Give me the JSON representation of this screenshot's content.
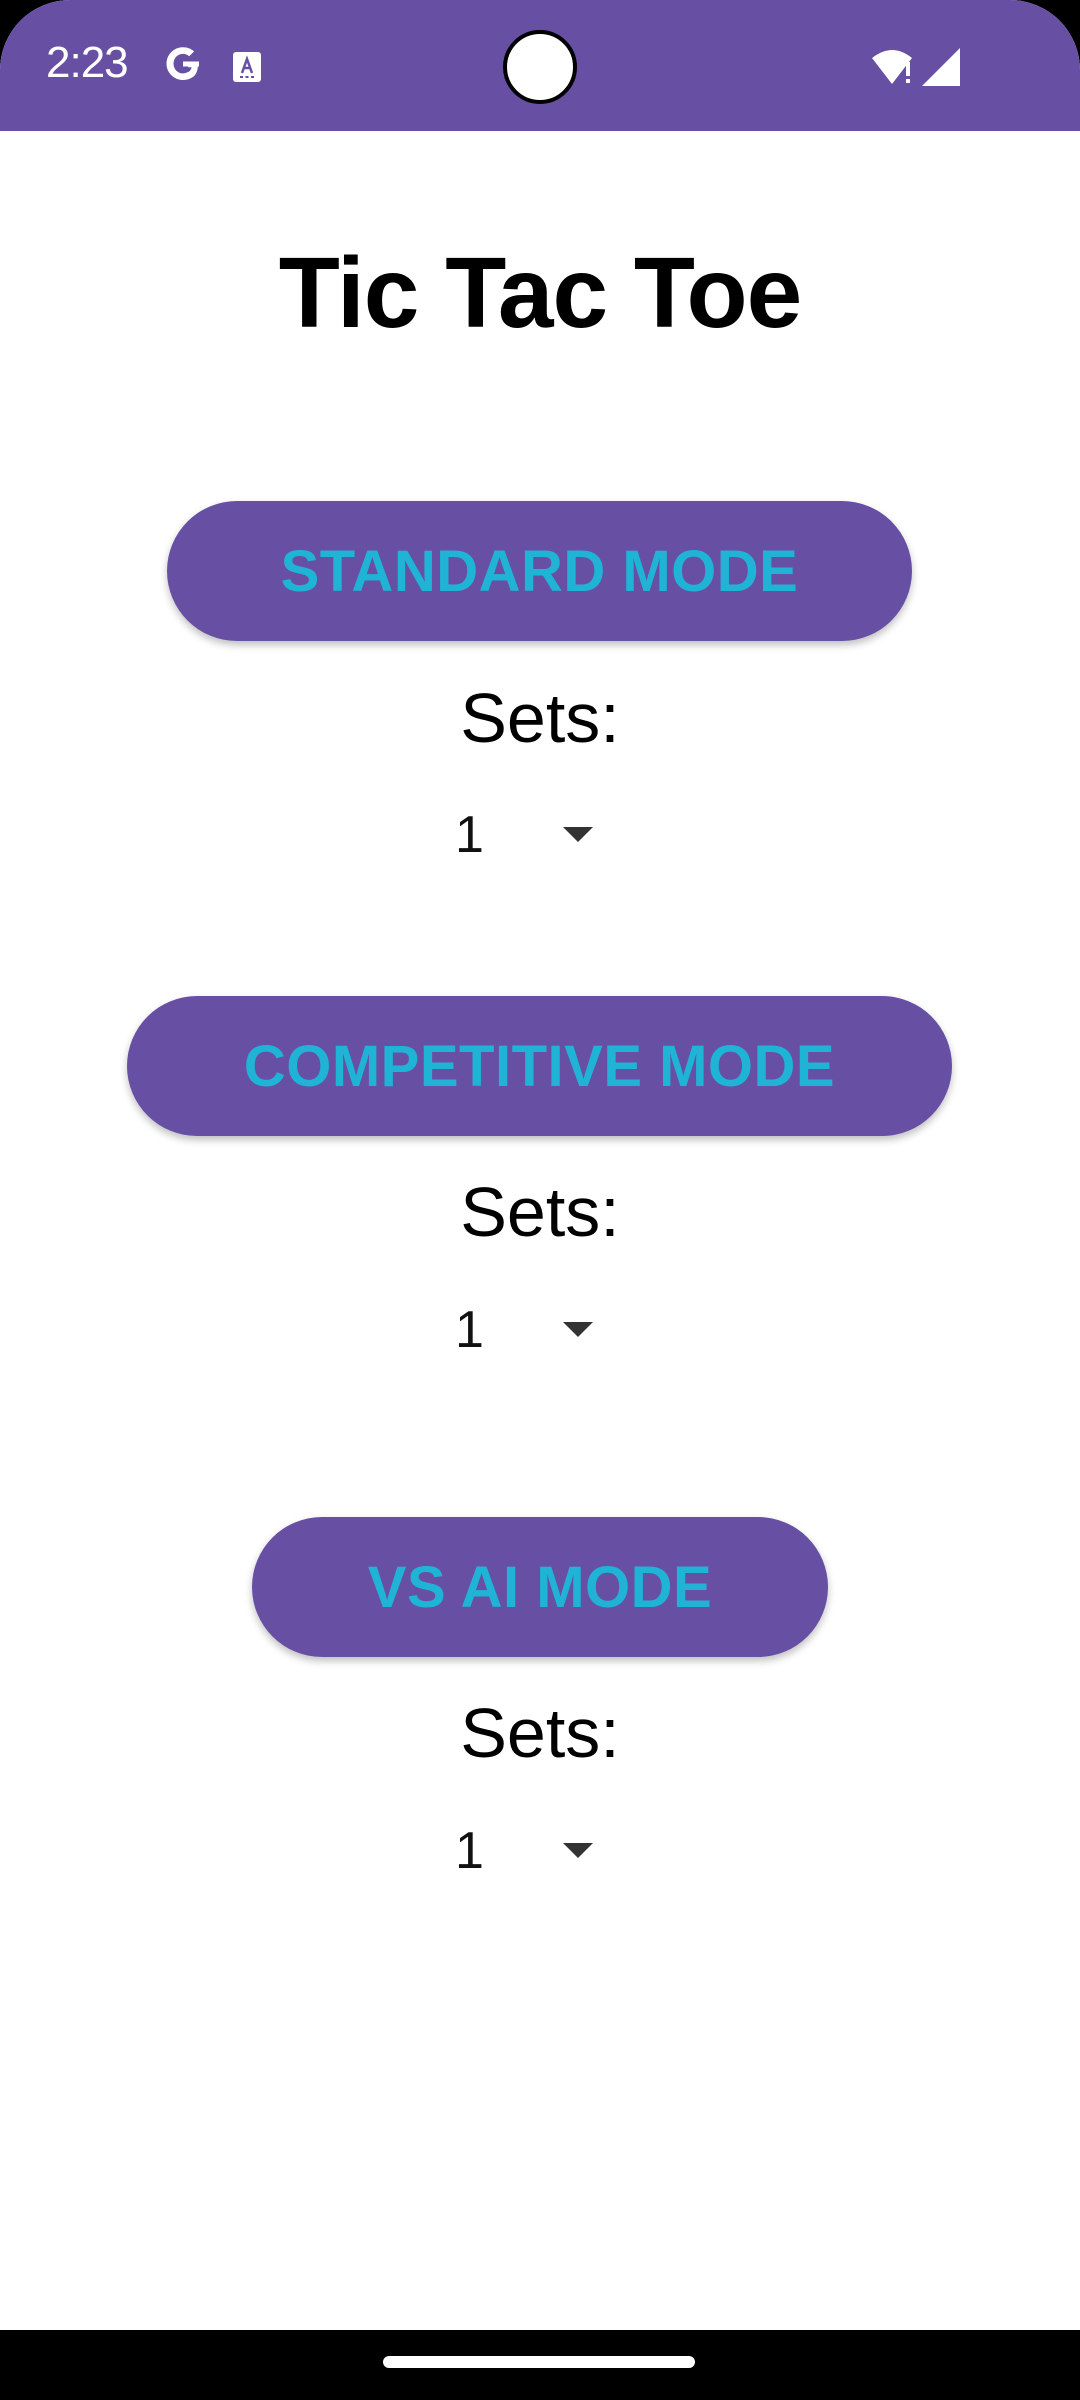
{
  "status_bar": {
    "time": "2:23",
    "icons": [
      "google-icon",
      "translate-icon",
      "camera-cutout",
      "wifi-icon",
      "signal-icon"
    ],
    "color": "#6750A4"
  },
  "title": "Tic Tac Toe",
  "modes": [
    {
      "label": "STANDARD MODE",
      "sets_label": "Sets:",
      "sets_value": "1"
    },
    {
      "label": "COMPETITIVE MODE",
      "sets_label": "Sets:",
      "sets_value": "1"
    },
    {
      "label": "VS AI MODE",
      "sets_label": "Sets:",
      "sets_value": "1"
    }
  ],
  "colors": {
    "primary": "#6750A4",
    "button_text": "#1FB4D6",
    "background": "#FFFFFF"
  }
}
